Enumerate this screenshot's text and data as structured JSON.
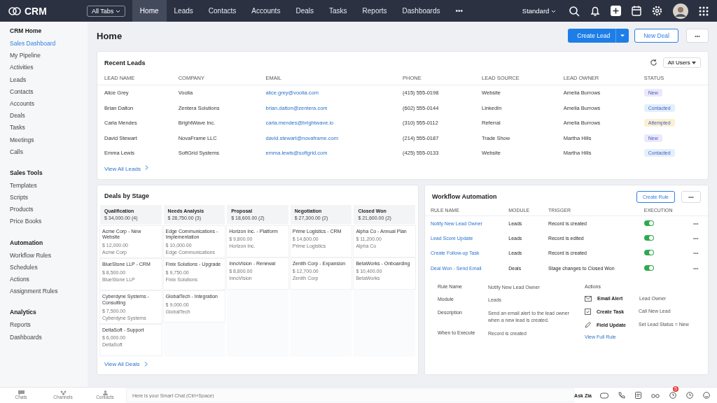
{
  "topbar": {
    "logo": "CRM",
    "all_tabs": "All Tabs",
    "tabs": [
      {
        "label": "Home",
        "selected": true
      },
      {
        "label": "Leads",
        "selected": false
      },
      {
        "label": "Contacts",
        "selected": false
      },
      {
        "label": "Accounts",
        "selected": false
      },
      {
        "label": "Deals",
        "selected": false
      },
      {
        "label": "Tasks",
        "selected": false
      },
      {
        "label": "Reports",
        "selected": false
      },
      {
        "label": "Dashboards",
        "selected": false
      }
    ],
    "more": "•••",
    "view": "Standard"
  },
  "sidebar": {
    "sections": [
      {
        "title": "CRM Home",
        "items": [
          {
            "label": "Sales Dashboard",
            "selected": true
          },
          {
            "label": "My Pipeline",
            "selected": false
          },
          {
            "label": "Activities",
            "selected": false
          },
          {
            "label": "Leads",
            "selected": false
          },
          {
            "label": "Contacts",
            "selected": false
          },
          {
            "label": "Accounts",
            "selected": false
          },
          {
            "label": "Deals",
            "selected": false
          },
          {
            "label": "Tasks",
            "selected": false
          },
          {
            "label": "Meetings",
            "selected": false
          },
          {
            "label": "Calls",
            "selected": false
          }
        ]
      },
      {
        "title": "Sales Tools",
        "items": [
          {
            "label": "Templates",
            "selected": false
          },
          {
            "label": "Scripts",
            "selected": false
          },
          {
            "label": "Products",
            "selected": false
          },
          {
            "label": "Price Books",
            "selected": false
          }
        ]
      },
      {
        "title": "Automation",
        "items": [
          {
            "label": "Workflow Rules",
            "selected": false
          },
          {
            "label": "Schedules",
            "selected": false
          },
          {
            "label": "Actions",
            "selected": false
          },
          {
            "label": "Assignment Rules",
            "selected": false
          }
        ]
      },
      {
        "title": "Analytics",
        "items": [
          {
            "label": "Reports",
            "selected": false
          },
          {
            "label": "Dashboards",
            "selected": false
          }
        ]
      }
    ]
  },
  "page": {
    "title": "Home",
    "create_lead": "Create Lead",
    "new_deal": "New Deal",
    "more": "•••"
  },
  "recent_leads": {
    "title": "Recent Leads",
    "filter": "All Users",
    "columns": [
      "LEAD NAME",
      "COMPANY",
      "EMAIL",
      "PHONE",
      "LEAD SOURCE",
      "LEAD OWNER",
      "STATUS"
    ],
    "rows": [
      {
        "name": "Alice Grey",
        "company": "Voolia",
        "email": "alice.grey@voolia.com",
        "phone": "(415) 555-0198",
        "source": "Website",
        "owner": "Amelia Burrows",
        "status": "New",
        "color": "#ece8fb"
      },
      {
        "name": "Brian Dalton",
        "company": "Zentera Solutions",
        "email": "brian.dalton@zentera.com",
        "phone": "(602) 555-0144",
        "source": "LinkedIn",
        "owner": "Amelia Burrows",
        "status": "Contacted",
        "color": "#e3effc"
      },
      {
        "name": "Carla Mendes",
        "company": "BrightWave Inc.",
        "email": "carla.mendes@brightwave.io",
        "phone": "(310) 555-0112",
        "source": "Referral",
        "owner": "Amelia Burrows",
        "status": "Attempted",
        "color": "#fdf0d2"
      },
      {
        "name": "David Stewart",
        "company": "NovaFrame LLC",
        "email": "david.stewart@novaframe.com",
        "phone": "(214) 555-0187",
        "source": "Trade Show",
        "owner": "Martha Hills",
        "status": "New",
        "color": "#ece8fb"
      },
      {
        "name": "Emma Lewis",
        "company": "SoftGrid Systems",
        "email": "emma.lewis@softgrid.com",
        "phone": "(425) 555-0133",
        "source": "Website",
        "owner": "Martha Hills",
        "status": "Contacted",
        "color": "#e3effc"
      }
    ],
    "view_all": "View All Leads"
  },
  "deals_by_stage": {
    "title": "Deals by Stage",
    "stages": [
      {
        "name": "Qualification",
        "total": "$ 34,000.00 (4)",
        "deals": [
          {
            "title": "Acme Corp - New Website",
            "amount": "$ 12,000.00",
            "account": "Acme Corp"
          },
          {
            "title": "BlueStone LLP - CRM",
            "amount": "$ 8,500.00",
            "account": "BlueStone LLP"
          },
          {
            "title": "Cyberdyne Systems - Consulting",
            "amount": "$ 7,500.00",
            "account": "Cyberdyne Systems"
          },
          {
            "title": "DeltaSoft - Support",
            "amount": "$ 6,000.00",
            "account": "DeltaSoft"
          }
        ]
      },
      {
        "name": "Needs Analysis",
        "total": "$ 28,750.00 (3)",
        "deals": [
          {
            "title": "Edge Communications - Implementation",
            "amount": "$ 10,000.00",
            "account": "Edge Communications"
          },
          {
            "title": "Finix Solutions - Upgrade",
            "amount": "$ 9,750.00",
            "account": "Finix Solutions"
          },
          {
            "title": "GlobalTech - Integration",
            "amount": "$ 9,000.00",
            "account": "GlobalTech"
          }
        ]
      },
      {
        "name": "Proposal",
        "total": "$ 18,600.00 (2)",
        "deals": [
          {
            "title": "Horizon Inc. - Platform",
            "amount": "$ 9,800.00",
            "account": "Horizon Inc."
          },
          {
            "title": "InnoVision - Renewal",
            "amount": "$ 8,800.00",
            "account": "InnoVision"
          }
        ]
      },
      {
        "name": "Negotiation",
        "total": "$ 27,300.00 (2)",
        "deals": [
          {
            "title": "Prime Logistics - CRM",
            "amount": "$ 14,600.00",
            "account": "Prime Logistics"
          },
          {
            "title": "Zenith Corp - Expansion",
            "amount": "$ 12,700.00",
            "account": "Zenith Corp"
          }
        ]
      },
      {
        "name": "Closed Won",
        "total": "$ 21,600.00 (2)",
        "deals": [
          {
            "title": "Alpha Co - Annual Plan",
            "amount": "$ 11,200.00",
            "account": "Alpha Co"
          },
          {
            "title": "BetaWorks - Onboarding",
            "amount": "$ 10,400.00",
            "account": "BetaWorks"
          }
        ]
      }
    ],
    "view_all": "View All Deals"
  },
  "workflow": {
    "title": "Workflow Automation",
    "create_rule": "Create Rule",
    "more": "•••",
    "columns": [
      "RULE NAME",
      "MODULE",
      "TRIGGER",
      "EXECUTION"
    ],
    "rules": [
      {
        "name": "Notify New Lead Owner",
        "module": "Leads",
        "trigger": "Record is created",
        "on": true,
        "more": "•••"
      },
      {
        "name": "Lead Score Update",
        "module": "Leads",
        "trigger": "Record is edited",
        "on": true,
        "more": "•••"
      },
      {
        "name": "Create Follow-up Task",
        "module": "Leads",
        "trigger": "Record is created",
        "on": true,
        "more": "•••"
      },
      {
        "name": "Deal Won - Send Email",
        "module": "Deals",
        "trigger": "Stage changes to Closed Won",
        "on": true,
        "more": "•••"
      }
    ],
    "details": [
      {
        "label": "Rule Name",
        "value": "Notify New Lead Owner"
      },
      {
        "label": "Module",
        "value": "Leads"
      },
      {
        "label": "Description",
        "value": "Send an email alert to the lead owner when a new lead is created."
      },
      {
        "label": "When to Execute",
        "value": "Record is created"
      }
    ],
    "actions_title": "Actions",
    "actions": [
      {
        "kind": "email",
        "name": "Email Alert",
        "value": "Lead Owner"
      },
      {
        "kind": "task",
        "name": "Create Task",
        "value": "Call New Lead"
      },
      {
        "kind": "update",
        "name": "Field Update",
        "value": "Set Lead Status = New"
      }
    ],
    "view_full": "View Full Rule"
  },
  "bottom_bar": {
    "items": [
      {
        "kind": "chat",
        "label": "Chats"
      },
      {
        "kind": "channel",
        "label": "Channels"
      },
      {
        "kind": "contact",
        "label": "Contacts"
      }
    ],
    "smart_chat": {
      "placeholder": "Here is your Smart Chat (Ctrl+Space)"
    },
    "ask_zia": "Ask Zia",
    "badge": "5"
  }
}
